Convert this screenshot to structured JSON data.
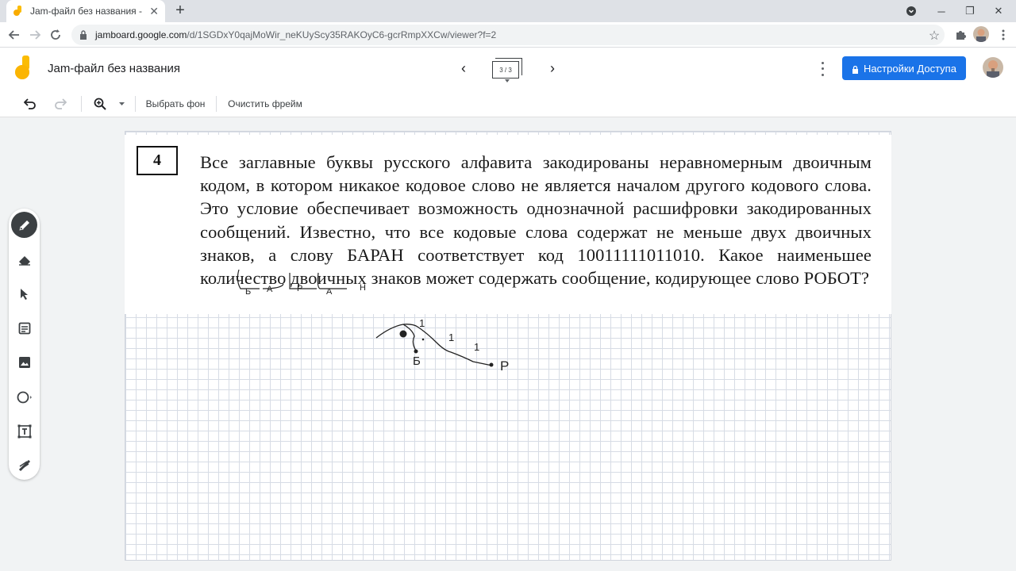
{
  "browser": {
    "tab_title": "Jam-файл без названия - Google",
    "tab_close": "✕",
    "new_tab": "+",
    "url_host": "jamboard.google.com",
    "url_path": "/d/1SGDxY0qajMoWir_neKUyScy35RAKOyC6-gcrRmpXXCw/viewer?f=2",
    "window_controls": {
      "minimize": "─",
      "restore": "❐",
      "close": "✕"
    }
  },
  "header": {
    "doc_title": "Jam-файл без названия",
    "frame_counter": "3 / 3",
    "share_button": "Настройки Доступа"
  },
  "toolbar": {
    "set_background": "Выбрать фон",
    "clear_frame": "Очистить фрейм"
  },
  "problem": {
    "number": "4",
    "text": "Все заглавные буквы русского алфавита закодированы неравномерным двоичным кодом, в котором никакое кодовое слово не является началом другого кодового слова. Это условие обеспечивает возможность однозначной расшифровки закодированных сообщений. Известно, что все кодовые слова содержат не меньше двух двоичных знаков, а слову БАРАН соответствует код 10011111011010. Какое наименьшее количество двоичных знаков может содержать сообщение, кодирующее слово РОБОТ?",
    "annotations": [
      "Б",
      "А",
      "Р",
      "А",
      "Н"
    ]
  },
  "drawing": {
    "labels": [
      "1",
      "1",
      "1",
      "Б",
      "Р"
    ]
  },
  "icons": {
    "tab_favicon": "jamboard-icon",
    "extensions": "puzzle-icon",
    "profile": "profile-avatar"
  },
  "colors": {
    "accent": "#1a73e8",
    "active_tool": "#3c4043",
    "logo_yellow": "#fbbc04"
  }
}
